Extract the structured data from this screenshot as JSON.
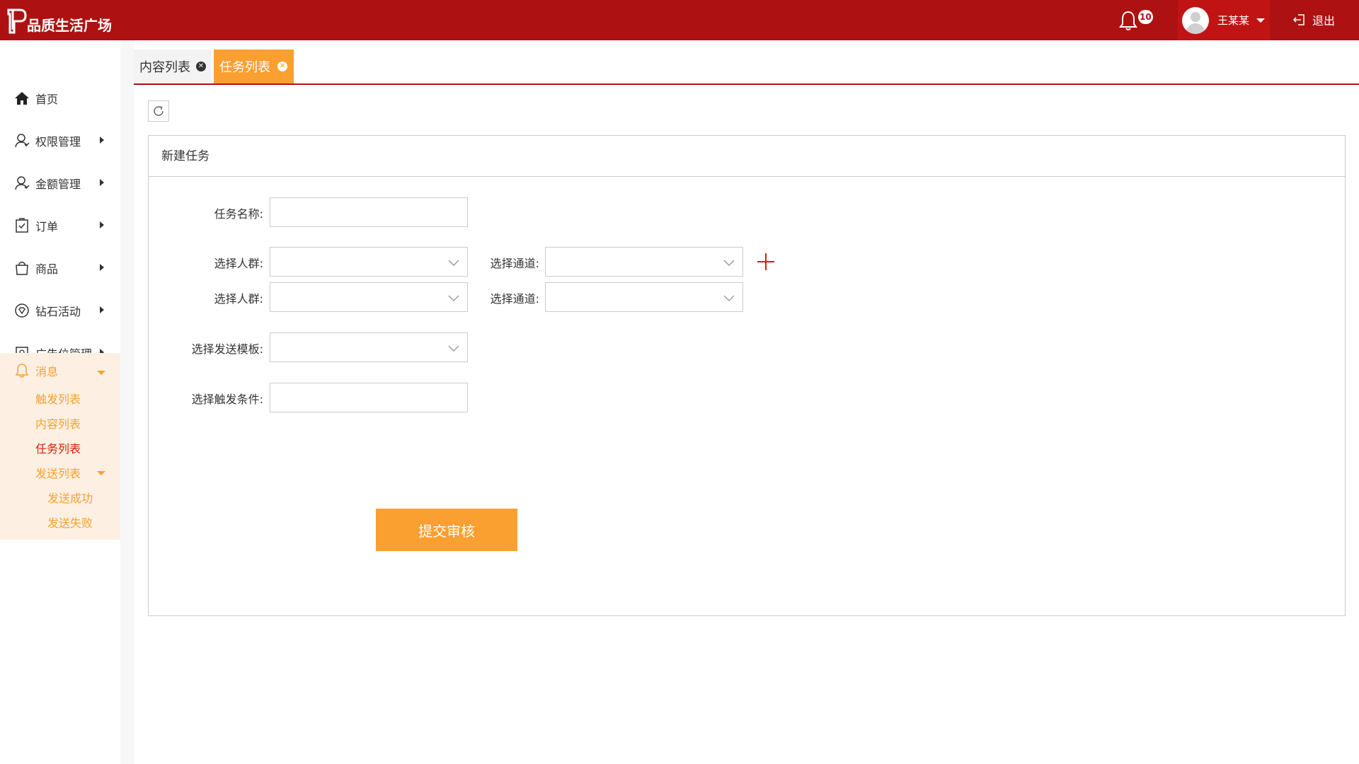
{
  "header": {
    "logo_mark": "ᴾP",
    "app_name": "品质生活广场",
    "notification_count": "10",
    "user_name": "王某某",
    "logout_label": "退出"
  },
  "sidebar": {
    "items": [
      {
        "label": "首页",
        "icon": "home-icon"
      },
      {
        "label": "权限管理",
        "icon": "user-icon"
      },
      {
        "label": "金额管理",
        "icon": "user-icon"
      },
      {
        "label": "订单",
        "icon": "clipboard-check-icon"
      },
      {
        "label": "商品",
        "icon": "shopping-bag-icon"
      },
      {
        "label": "钻石活动",
        "icon": "diamond-circle-icon"
      },
      {
        "label": "广告位管理",
        "icon": "ad-board-icon"
      }
    ],
    "message": {
      "label": "消息",
      "icon": "bell-icon",
      "sub": [
        "触发列表",
        "内容列表",
        "任务列表"
      ],
      "send": {
        "label": "发送列表",
        "sub": [
          "发送成功",
          "发送失败"
        ]
      }
    }
  },
  "tabs": [
    {
      "label": "内容列表",
      "active": false
    },
    {
      "label": "任务列表",
      "active": true
    }
  ],
  "panel": {
    "title": "新建任务",
    "task_name_label": "任务名称:",
    "crowd_label": "选择人群:",
    "channel_label": "选择通道:",
    "template_label": "选择发送模板:",
    "trigger_label": "选择触发条件:",
    "submit_label": "提交审核"
  },
  "colors": {
    "brand_red": "#ae1111",
    "accent_orange": "#f9a030",
    "active_red": "#d81e06"
  }
}
